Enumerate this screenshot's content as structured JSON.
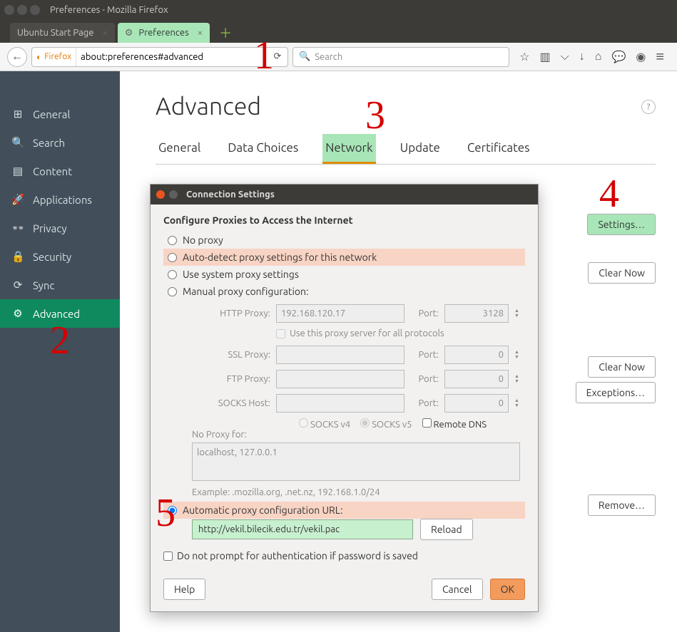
{
  "window": {
    "title": "Preferences - Mozilla Firefox"
  },
  "tabs": {
    "inactive_label": "Ubuntu Start Page",
    "active_label": "Preferences"
  },
  "url": {
    "identity": "Firefox",
    "value": "about:preferences#advanced"
  },
  "search": {
    "placeholder": "Search"
  },
  "sidebar": {
    "items": [
      {
        "icon": "⊞",
        "label": "General"
      },
      {
        "icon": "🔍",
        "label": "Search"
      },
      {
        "icon": "▤",
        "label": "Content"
      },
      {
        "icon": "🚀",
        "label": "Applications"
      },
      {
        "icon": "👓",
        "label": "Privacy"
      },
      {
        "icon": "🔒",
        "label": "Security"
      },
      {
        "icon": "⟳",
        "label": "Sync"
      },
      {
        "icon": "⚙",
        "label": "Advanced"
      }
    ]
  },
  "page": {
    "title": "Advanced",
    "subtabs": [
      "General",
      "Data Choices",
      "Network",
      "Update",
      "Certificates"
    ],
    "active_subtab": "Network",
    "settings_btn": "Settings…",
    "clear_now1": "Clear Now",
    "clear_now2": "Clear Now",
    "exceptions": "Exceptions…",
    "remove": "Remove…"
  },
  "modal": {
    "title": "Connection Settings",
    "section": "Configure Proxies to Access the Internet",
    "no_proxy": "No proxy",
    "auto_detect": "Auto-detect proxy settings for this network",
    "use_system": "Use system proxy settings",
    "manual": "Manual proxy configuration:",
    "http_label": "HTTP Proxy:",
    "http_val": "192.168.120.17",
    "http_port": "3128",
    "use_all": "Use this proxy server for all protocols",
    "ssl_label": "SSL Proxy:",
    "ftp_label": "FTP Proxy:",
    "socks_label": "SOCKS Host:",
    "port_label": "Port:",
    "port_zero": "0",
    "socks_v4": "SOCKS v4",
    "socks_v5": "SOCKS v5",
    "remote_dns": "Remote DNS",
    "noproxy_label": "No Proxy for:",
    "noproxy_val": "localhost, 127.0.0.1",
    "example": "Example: .mozilla.org, .net.nz, 192.168.1.0/24",
    "pac_label": "Automatic proxy configuration URL:",
    "pac_val": "http://vekil.bilecik.edu.tr/vekil.pac",
    "reload": "Reload",
    "no_prompt": "Do not prompt for authentication if password is saved",
    "help": "Help",
    "cancel": "Cancel",
    "ok": "OK"
  },
  "annotations": {
    "a1": "1",
    "a2": "2",
    "a3": "3",
    "a4": "4",
    "a5": "5"
  }
}
